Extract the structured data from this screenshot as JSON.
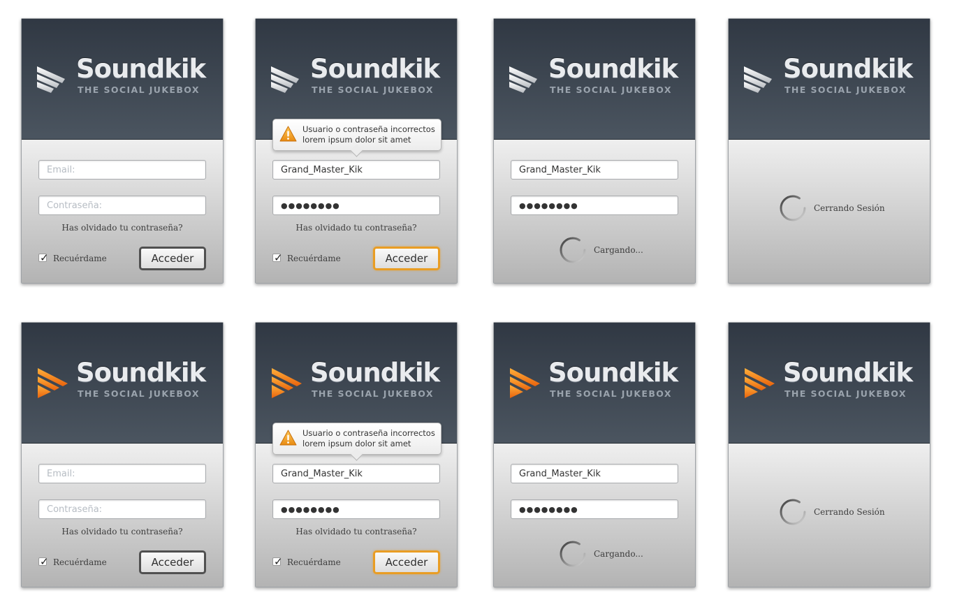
{
  "brand": {
    "name": "Soundkik",
    "tagline": "THE SOCIAL JUKEBOX",
    "accent_orange": "#f0801c",
    "logo_gray": "#e4e6e9"
  },
  "login": {
    "email_placeholder": "Email:",
    "password_placeholder": "Contraseña:",
    "forgot_link": "Has olvidado tu contraseña?",
    "remember_label": "Recuérdame",
    "remember_checked": true,
    "submit_label": "Acceder",
    "username_value": "Grand_Master_Kik",
    "password_value": "●●●●●●●●"
  },
  "error_tooltip": {
    "line1": "Usuario o contraseña incorrectos",
    "line2": "lorem ipsum dolor sit amet"
  },
  "loading": {
    "label": "Cargando..."
  },
  "logout": {
    "label": "Cerrando Sesión"
  },
  "icons": {
    "logo_mark_gray": "sound-waves-icon",
    "logo_mark_orange": "sound-waves-icon",
    "warning": "warning-icon",
    "spinner": "spinner-icon",
    "checkbox": "checkbox-checked-icon"
  }
}
